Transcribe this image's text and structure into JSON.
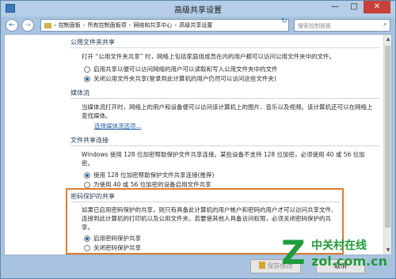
{
  "window": {
    "title": "高级共享设置",
    "min_glyph": "—",
    "max_glyph": "□",
    "close_glyph": "✕"
  },
  "nav": {
    "back_glyph": "←",
    "forward_glyph": "→",
    "refresh_glyph": "↻",
    "breadcrumbs": [
      "控制面板",
      "所有控制面板项",
      "网络和共享中心",
      "高级共享设置"
    ],
    "separator": "›",
    "search_placeholder": "搜索控制面板",
    "search_glyph": "⌕"
  },
  "sections": {
    "public_folder": {
      "title": "公用文件夹共享",
      "desc": "打开 “公用文件夹共享” 时，网络上包括家庭组成员在内的用户都可以访问公用文件夹中的文件。",
      "options": [
        {
          "label": "启用共享以便可以访问网络的用户可以读取和写入公用文件夹中的文件",
          "selected": false
        },
        {
          "label": "关闭公用文件夹共享(登录到此计算机的用户仍然可以访问这些文件夹)",
          "selected": true
        }
      ]
    },
    "media": {
      "title": "媒体流",
      "desc": "当媒体流打开时，网络上的用户和设备便可以访问该计算机上的图片、音乐以及视频。该计算机还可以在网络上查找媒体。",
      "link": "选择媒体流选项..."
    },
    "file_sharing": {
      "title": "文件共享连接",
      "desc": "Windows 使用 128 位加密帮助保护文件共享连接。某些设备不支持 128 位加密，必须使用 40 或 56 位加密。",
      "options": [
        {
          "label": "使用 128 位加密帮助保护文件共享连接(推荐)",
          "selected": true
        },
        {
          "label": "为使用 40 或 56 位加密的设备启用文件共享",
          "selected": false
        }
      ]
    },
    "password": {
      "title": "密码保护的共享",
      "desc": "如果已启用密码保护的共享，则只有具备此计算机的用户帐户和密码的用户才可以访问共享文件、连接到此计算机的打印机以及公用文件夹。若要使其他人具备访问权限，必须关闭密码保护的共享。",
      "options": [
        {
          "label": "启用密码保护共享",
          "selected": true
        },
        {
          "label": "关闭密码保护共享",
          "selected": false
        }
      ]
    }
  },
  "footer": {
    "save_label": "保存修改",
    "cancel_label": "取消"
  },
  "watermark": {
    "z": "Z",
    "cn": "中关村在线",
    "en": "zol.com.cn"
  },
  "colors": {
    "highlight_border": "#e07d2a",
    "link": "#1f5fa8",
    "watermark": "#1f9b3a"
  }
}
